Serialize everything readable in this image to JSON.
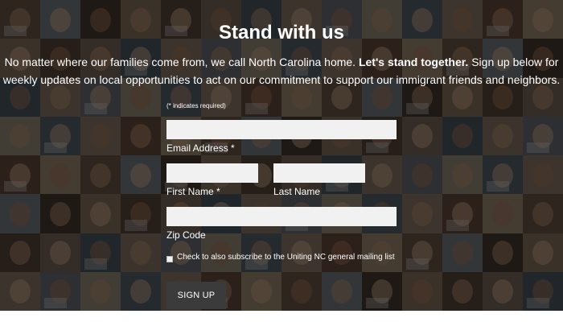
{
  "page": {
    "title": "Stand with us",
    "intro_part1": "No matter where our families come from, we call North Carolina home. ",
    "intro_bold": "Let's stand together.",
    "intro_part2": " Sign up below for weekly updates on local opportunities to act on our commitment to support our immigrant friends and neighbors."
  },
  "form": {
    "required_note": "(* indicates required)",
    "email": {
      "label": "Email Address *",
      "value": ""
    },
    "first_name": {
      "label": "First Name *",
      "value": ""
    },
    "last_name": {
      "label": "Last Name",
      "value": ""
    },
    "zip": {
      "label": "Zip Code",
      "value": ""
    },
    "subscribe_label": "Check to also subscribe to the Uniting NC general mailing list",
    "subscribe_checked": false,
    "submit_label": "SIGN UP"
  },
  "background": {
    "tile_colors": [
      "#6e5a4a",
      "#8a7563",
      "#4f5b66",
      "#9b8f7c",
      "#6a4f3f",
      "#7a8288",
      "#5c4a3c",
      "#8c7a6a",
      "#5a6470",
      "#a38c76",
      "#4b3c33",
      "#7d6c5e",
      "#6b7077",
      "#927e6c"
    ],
    "skin_tones": [
      "#c89a7a",
      "#8a5c44",
      "#e0b896",
      "#5e3e2c",
      "#b07e5e",
      "#d4a888"
    ],
    "overlay_color": "#000000"
  }
}
